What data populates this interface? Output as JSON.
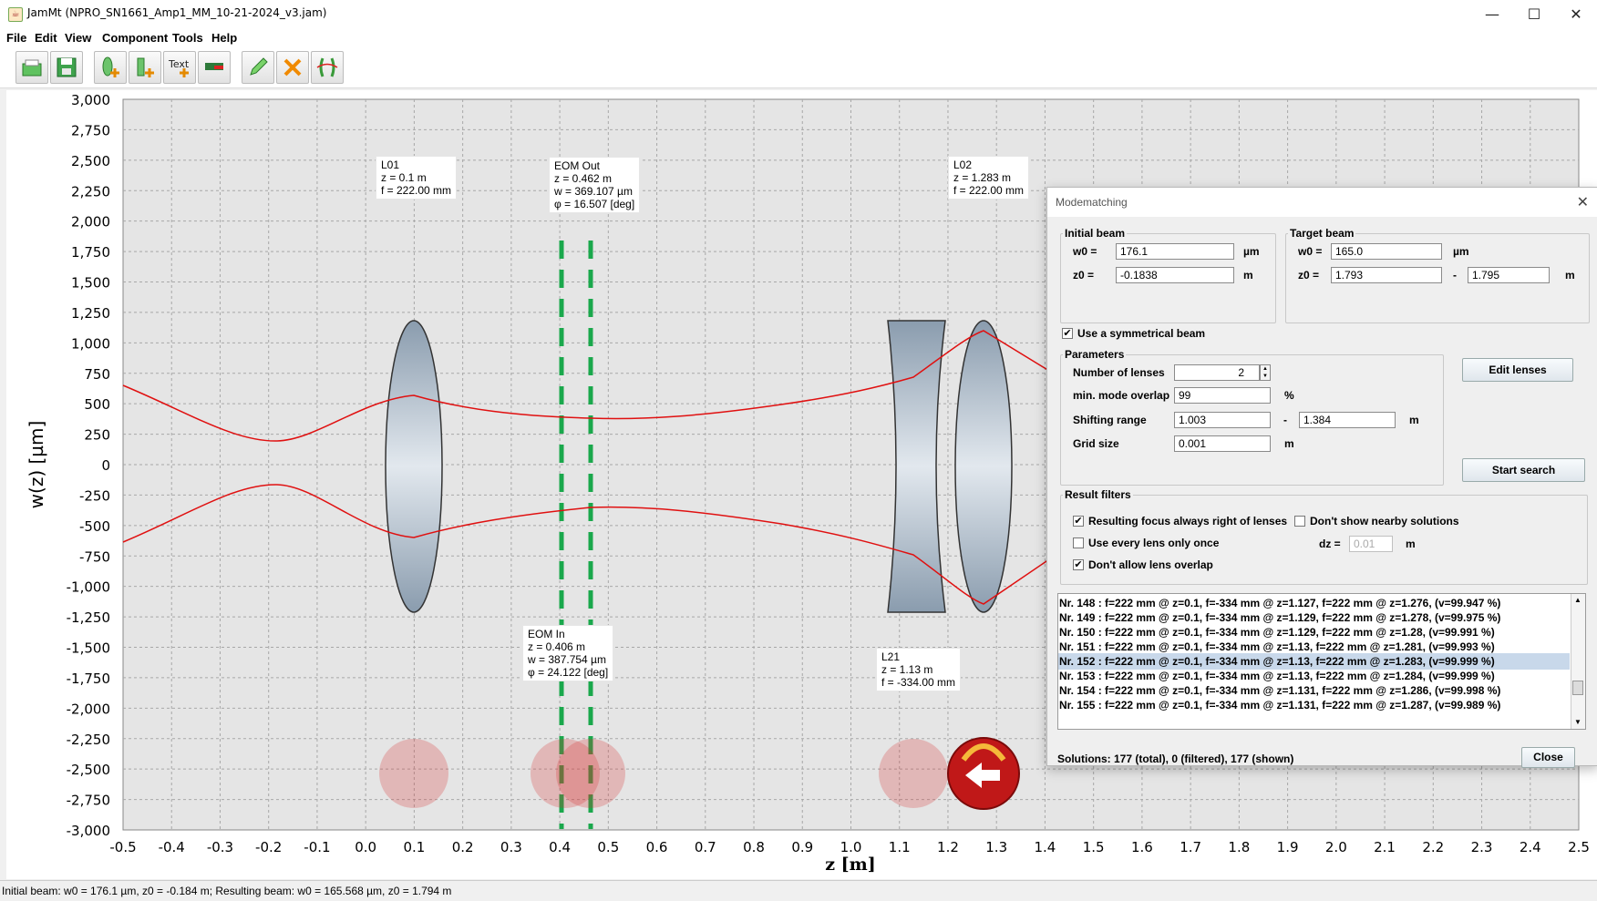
{
  "window": {
    "title": "JamMt (NPRO_SN1661_Amp1_MM_10-21-2024_v3.jam)",
    "minimize": "—",
    "maximize": "☐",
    "close": "✕"
  },
  "menu": [
    "File",
    "Edit",
    "View",
    "Component",
    "Tools",
    "Help"
  ],
  "toolbar": {
    "buttons": [
      "open-icon",
      "save-icon",
      "add-lens-icon",
      "add-beam-icon",
      "add-text-icon",
      "add-measure-icon",
      "edit-pencil-icon",
      "delete-x-icon",
      "modematching-icon"
    ],
    "text_icon_label": "Text"
  },
  "plot": {
    "ylabel": "w(z) [µm]",
    "xlabel": "z [m]",
    "yticks": [
      "3,000",
      "2,750",
      "2,500",
      "2,250",
      "2,000",
      "1,750",
      "1,500",
      "1,250",
      "1,000",
      "750",
      "500",
      "250",
      "0",
      "-250",
      "-500",
      "-750",
      "-1,000",
      "-1,250",
      "-1,500",
      "-1,750",
      "-2,000",
      "-2,250",
      "-2,500",
      "-2,750",
      "-3,000"
    ],
    "xticks": [
      "-0.5",
      "-0.4",
      "-0.3",
      "-0.2",
      "-0.1",
      "0.0",
      "0.1",
      "0.2",
      "0.3",
      "0.4",
      "0.5",
      "0.6",
      "0.7",
      "0.8",
      "0.9",
      "1.0",
      "1.1",
      "1.2",
      "1.3",
      "1.4",
      "1.5",
      "1.6",
      "1.7",
      "1.8",
      "1.9",
      "2.0",
      "2.1",
      "2.2",
      "2.3",
      "2.4",
      "2.5"
    ],
    "beam_color": "#e01010",
    "eom_color": "#1aa84c",
    "labels": {
      "l01": [
        "L01",
        "z = 0.1 m",
        "f = 222.00 mm"
      ],
      "eom_out": [
        "EOM Out",
        "z = 0.462 m",
        "w = 369.107 µm",
        "φ = 16.507 [deg]"
      ],
      "l02": [
        "L02",
        "z = 1.283 m",
        "f = 222.00 mm"
      ],
      "eom_in": [
        "EOM In",
        "z = 0.406 m",
        "w = 387.754 µm",
        "φ = 24.122 [deg]"
      ],
      "l21": [
        "L21",
        "z = 1.13 m",
        "f = -334.00 mm"
      ]
    }
  },
  "dialog": {
    "title": "Modematching",
    "close_x": "✕",
    "initial_beam": {
      "title": "Initial beam",
      "w0_label": "w0 =",
      "w0": "176.1",
      "w0_unit": "µm",
      "z0_label": "z0 =",
      "z0": "-0.1838",
      "z0_unit": "m"
    },
    "target_beam": {
      "title": "Target beam",
      "w0_label": "w0 =",
      "w0": "165.0",
      "w0_unit": "µm",
      "z0_label": "z0 =",
      "z0_from": "1.793",
      "dash": "-",
      "z0_to": "1.795",
      "z0_unit": "m"
    },
    "symmetrical": {
      "label": "Use a symmetrical beam",
      "checked": "✔"
    },
    "parameters": {
      "title": "Parameters",
      "lenses_label": "Number of lenses",
      "lenses": "2",
      "overlap_label": "min. mode overlap",
      "overlap": "99",
      "overlap_unit": "%",
      "shift_label": "Shifting range",
      "shift_from": "1.003",
      "dash": "-",
      "shift_to": "1.384",
      "shift_unit": "m",
      "grid_label": "Grid size",
      "grid": "0.001",
      "grid_unit": "m"
    },
    "edit_lenses": "Edit lenses",
    "start_search": "Start search",
    "filters": {
      "title": "Result filters",
      "focus_right": "Resulting focus always right of lenses",
      "nearby": "Don't show nearby solutions",
      "once": "Use every lens only once",
      "dz_label": "dz =",
      "dz": "0.01",
      "dz_unit": "m",
      "overlap": "Don't allow lens overlap",
      "check": "✔"
    },
    "results": [
      "Nr. 148 : f=222 mm @ z=0.1, f=-334 mm @ z=1.127, f=222 mm @ z=1.276,  (v=99.947 %)",
      "Nr. 149 : f=222 mm @ z=0.1, f=-334 mm @ z=1.129, f=222 mm @ z=1.278,  (v=99.975 %)",
      "Nr. 150 : f=222 mm @ z=0.1, f=-334 mm @ z=1.129, f=222 mm @ z=1.28,  (v=99.991 %)",
      "Nr. 151 : f=222 mm @ z=0.1, f=-334 mm @ z=1.13, f=222 mm @ z=1.281,  (v=99.993 %)",
      "Nr. 152 : f=222 mm @ z=0.1, f=-334 mm @ z=1.13, f=222 mm @ z=1.283,  (v=99.999 %)",
      "Nr. 153 : f=222 mm @ z=0.1, f=-334 mm @ z=1.13, f=222 mm @ z=1.284,  (v=99.999 %)",
      "Nr. 154 : f=222 mm @ z=0.1, f=-334 mm @ z=1.131, f=222 mm @ z=1.286,  (v=99.998 %)",
      "Nr. 155 : f=222 mm @ z=0.1, f=-334 mm @ z=1.131, f=222 mm @ z=1.287,  (v=99.989 %)"
    ],
    "selected_index": 4,
    "solutions": "Solutions: 177 (total), 0 (filtered), 177 (shown)",
    "close": "Close"
  },
  "status": "Initial beam: w0 = 176.1 µm, z0 = -0.184 m; Resulting beam: w0 = 165.568 µm, z0 = 1.794 m"
}
